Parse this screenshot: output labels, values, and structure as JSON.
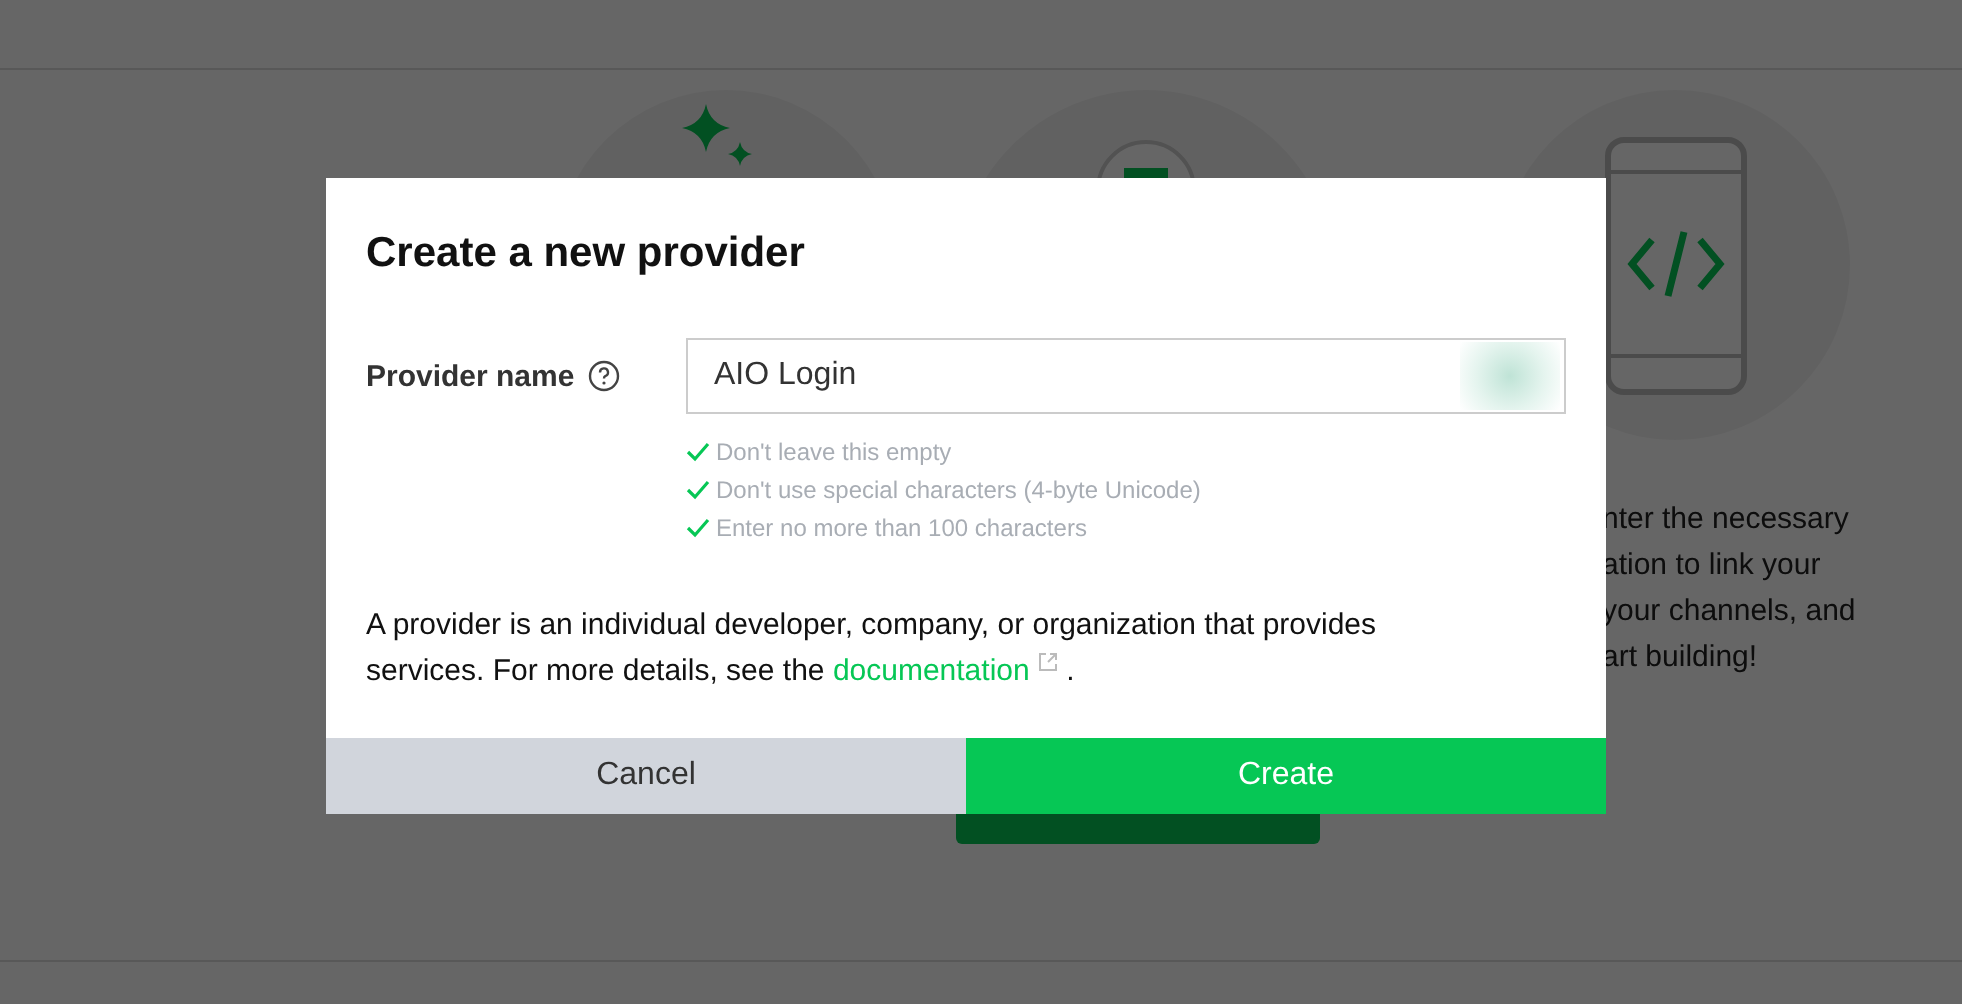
{
  "background": {
    "text_lines": [
      "nter the necessary",
      "ation to link your",
      "your channels, and",
      "art building!"
    ]
  },
  "dialog": {
    "title": "Create a new provider",
    "field": {
      "label": "Provider name",
      "value": "AIO Login"
    },
    "rules": [
      {
        "text": "Don't leave this empty",
        "met": true
      },
      {
        "text": "Don't use special characters (4-byte Unicode)",
        "met": true
      },
      {
        "text": "Enter no more than 100 characters",
        "met": true
      }
    ],
    "description": "A provider is an individual developer, company, or organization that provides services. For more details, see the ",
    "link": "documentation",
    "after_link": " .",
    "buttons": [
      {
        "label": "Cancel",
        "kind": "secondary"
      },
      {
        "label": "Create",
        "kind": "primary"
      }
    ]
  }
}
